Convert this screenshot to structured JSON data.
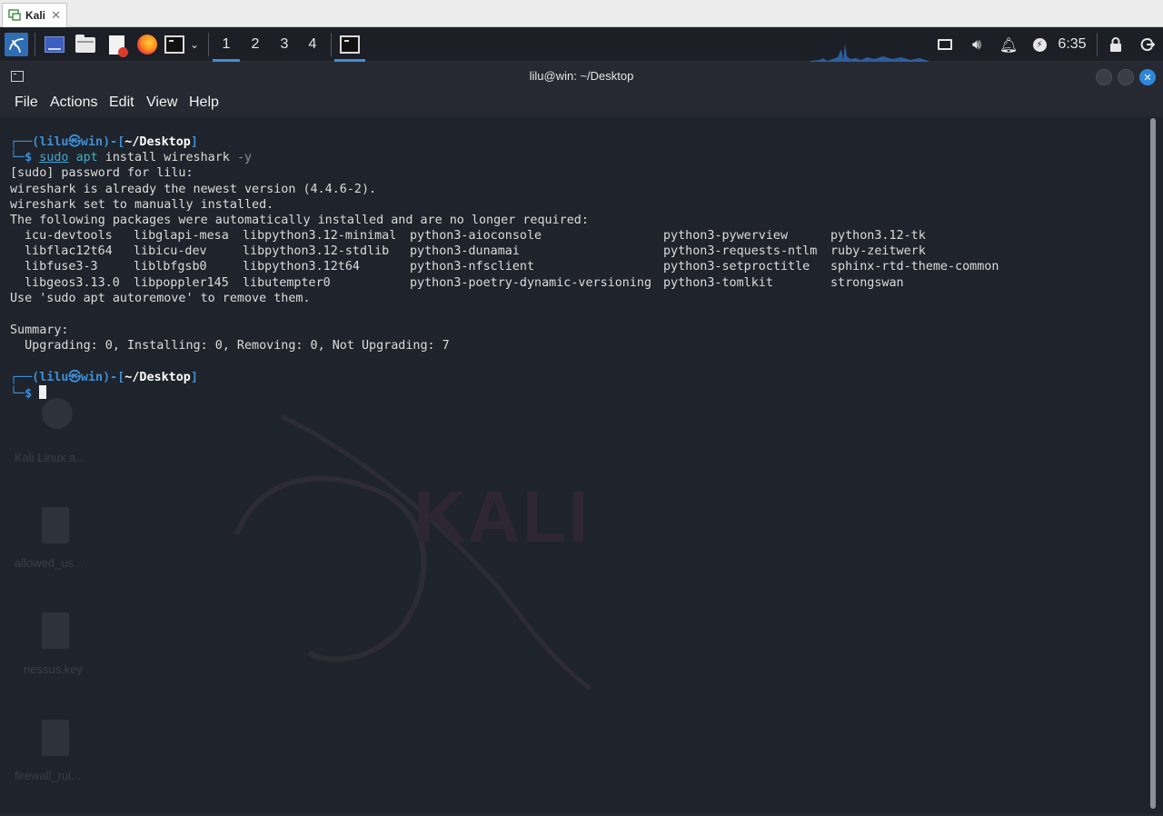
{
  "vm_tab": {
    "label": "Kali",
    "close": "✕"
  },
  "panel": {
    "workspaces": [
      "1",
      "2",
      "3",
      "4"
    ],
    "clock": "6:35"
  },
  "window": {
    "title": "lilu@win: ~/Desktop",
    "menu": [
      "File",
      "Actions",
      "Edit",
      "View",
      "Help"
    ]
  },
  "terminal": {
    "prompt": {
      "user": "lilu",
      "at": "㉿",
      "host": "win",
      "dir": "~/Desktop",
      "symbol": "$"
    },
    "command": {
      "sudo": "sudo",
      "apt": "apt",
      "args": " install wireshark ",
      "flag": "-y"
    },
    "output": [
      "[sudo] password for lilu:",
      "wireshark is already the newest version (4.4.6-2).",
      "wireshark set to manually installed.",
      "The following packages were automatically installed and are no longer required:"
    ],
    "packages": [
      [
        "icu-devtools",
        "libglapi-mesa",
        "libpython3.12-minimal",
        "python3-aioconsole",
        "python3-pywerview",
        "python3.12-tk"
      ],
      [
        "libflac12t64",
        "libicu-dev",
        "libpython3.12-stdlib",
        "python3-dunamai",
        "python3-requests-ntlm",
        "ruby-zeitwerk"
      ],
      [
        "libfuse3-3",
        "liblbfgsb0",
        "libpython3.12t64",
        "python3-nfsclient",
        "python3-setproctitle",
        "sphinx-rtd-theme-common"
      ],
      [
        "libgeos3.13.0",
        "libpoppler145",
        "libutempter0",
        "python3-poetry-dynamic-versioning",
        "python3-tomlkit",
        "strongswan"
      ]
    ],
    "autoremove": "Use 'sudo apt autoremove' to remove them.",
    "summary_label": "Summary:",
    "summary": "  Upgrading: 0, Installing: 0, Removing: 0, Not Upgrading: 7"
  },
  "desktop": {
    "watermark": "KALI",
    "icons": [
      "Kali Linux a...",
      "allowed_us...",
      "nessus.key",
      "firewall_rul..."
    ]
  },
  "colors": {
    "panel_bg": "#1d1f26",
    "terminal_bg": "#1f232b",
    "prompt_blue": "#3d8fd6",
    "accent": "#3d8fd6"
  }
}
